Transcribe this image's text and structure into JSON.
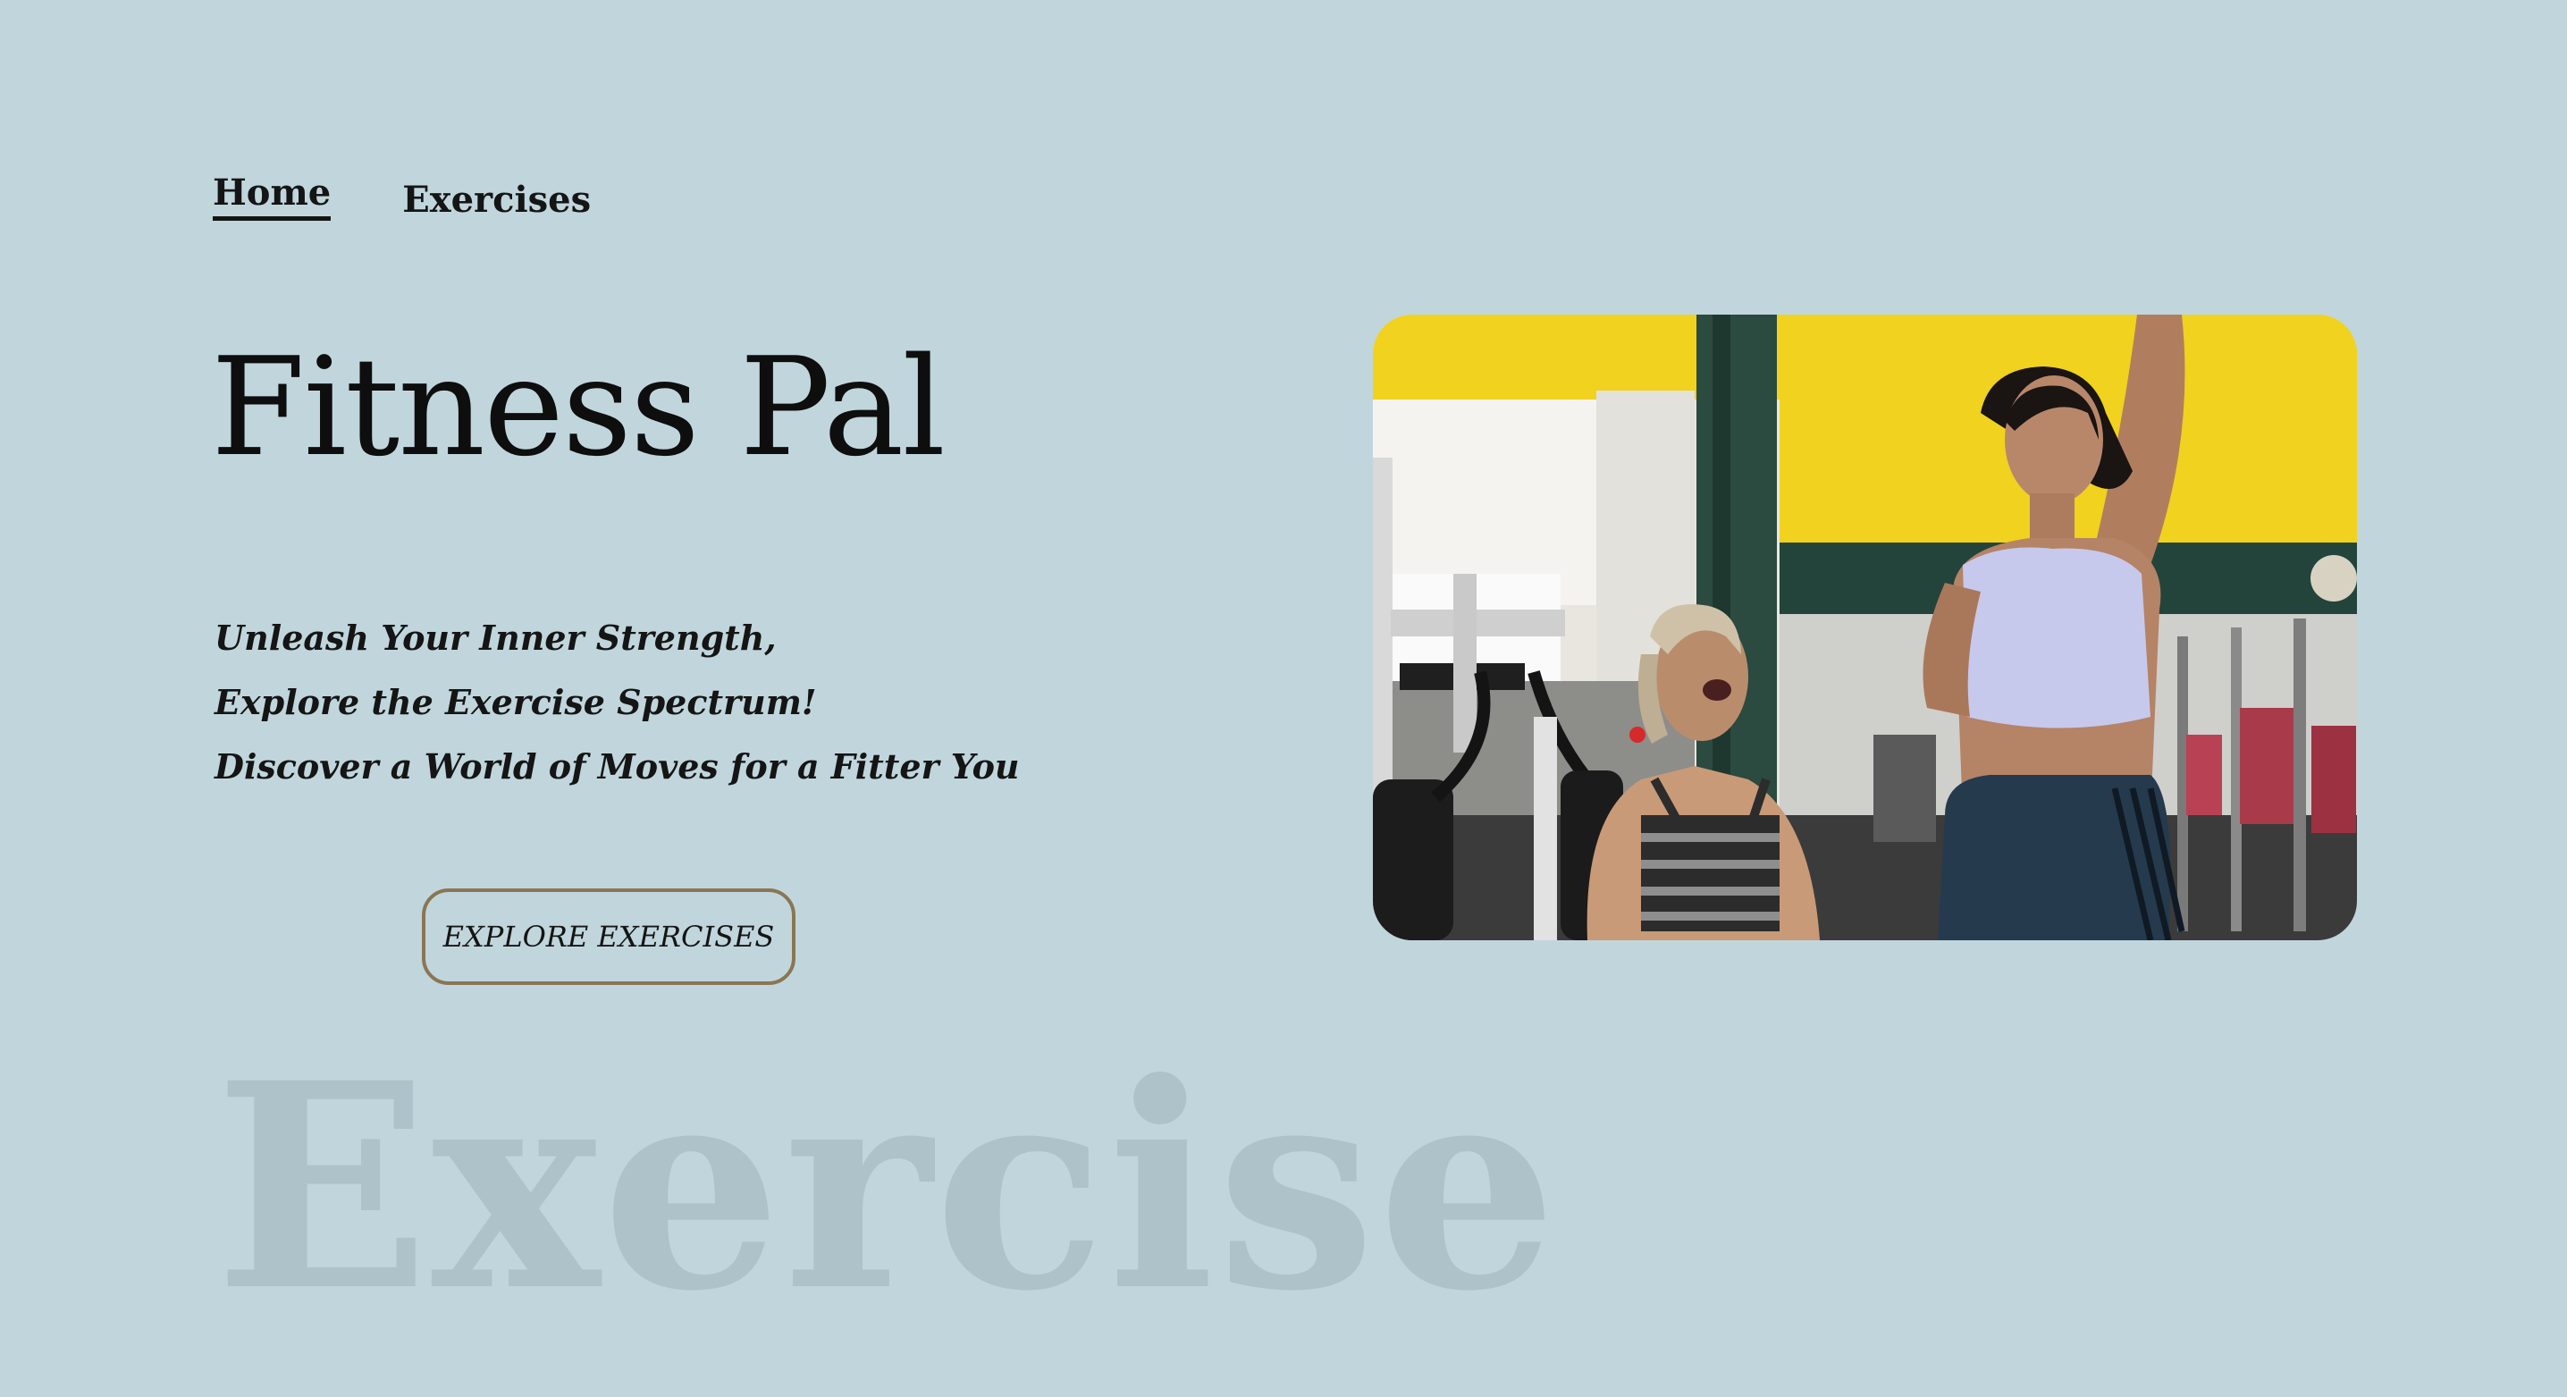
{
  "nav": {
    "items": [
      {
        "label": "Home",
        "active": true
      },
      {
        "label": "Exercises",
        "active": false
      }
    ]
  },
  "hero": {
    "title": "Fitness Pal",
    "tagline": [
      "Unleash Your Inner Strength,",
      "Explore the Exercise Spectrum!",
      "Discover a World of Moves for a Fitter You"
    ],
    "cta_label": "EXPLORE EXERCISES",
    "image_subject": "two-women-laughing-in-gym-photo"
  },
  "watermark": "Exercise",
  "colors": {
    "background": "#c0d6dc",
    "text": "#151515",
    "button_border": "#8a7654",
    "watermark": "#adc2c9",
    "photo_accent_yellow": "#f0d21f"
  }
}
